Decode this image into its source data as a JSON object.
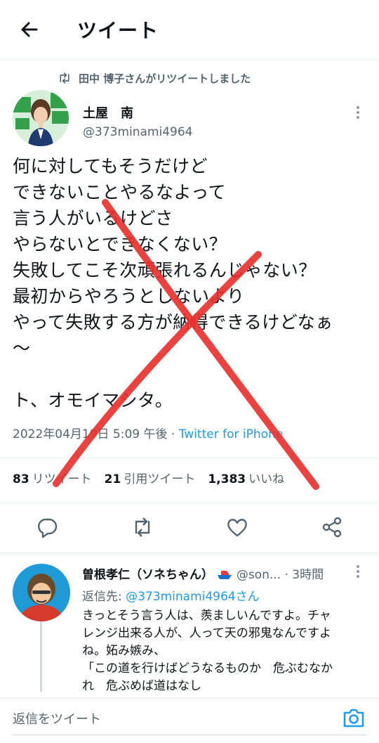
{
  "header": {
    "title": "ツイート"
  },
  "retweet_context": {
    "text": "田中 博子さんがリツイートしました"
  },
  "tweet": {
    "author_name": "土屋　南",
    "handle": "@373minami4964",
    "body_lines": [
      "何に対してもそうだけど",
      "できないことやるなよって",
      "言う人がいるけどさ",
      "やらないとできなくない？",
      "失敗してこそ次頑張れるんじゃない？",
      "最初からやろうとしないより",
      "やって失敗する方が納得できるけどなぁ",
      "〜",
      "",
      "ト、オモイマシタ。"
    ],
    "timestamp": "2022年04月19日 5:09 午後",
    "separator": " · ",
    "source": "Twitter for iPhone",
    "retweets_count": "83",
    "retweets_label": "リツイート",
    "quotes_count": "21",
    "quotes_label": "引用ツイート",
    "likes_count": "1,383",
    "likes_label": "いいね"
  },
  "reply": {
    "author_name": "曽根孝仁（ソネちゃん）",
    "handle": "@son...",
    "time": "· 3時間",
    "replying_to_label": "返信先: ",
    "replying_to_handle": "@373minami4964さん",
    "body_lines": [
      "きっとそう言う人は、羨ましいんですよ。チャ",
      "レンジ出来る人が、人って天の邪鬼なんですよ",
      "ね。妬み嫉み、",
      "「この道を行けばどうなるものか　危ぶむなか",
      "れ　危ぶめば道はなし"
    ]
  },
  "composer": {
    "placeholder": "返信をツイート"
  },
  "colors": {
    "accent": "#1d9bf0",
    "secondary_text": "#536471",
    "x_mark": "#e8322e"
  }
}
